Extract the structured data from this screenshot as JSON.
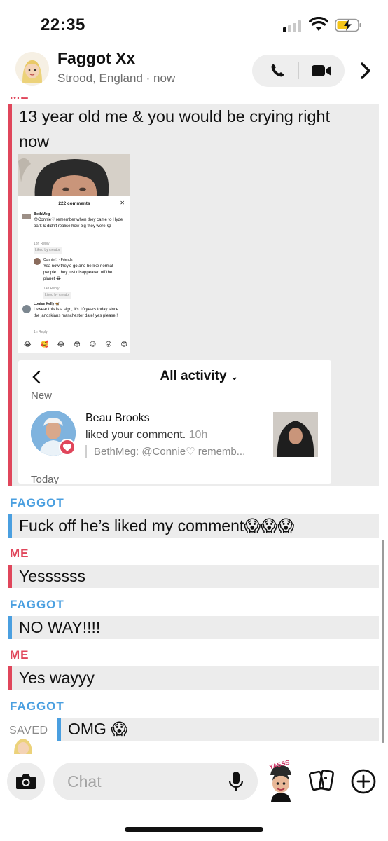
{
  "status": {
    "time": "22:35"
  },
  "header": {
    "name": "Faggot Xx",
    "subtitle": "Strood, England · now"
  },
  "colors": {
    "me": "#e0465b",
    "them": "#4a9fe0",
    "bubble_bg": "#ececec"
  },
  "messages": [
    {
      "sender": "ME",
      "text": "13 year old me & you would be crying right now"
    },
    {
      "sender": "FAGGOT",
      "text": "Fuck off he’s liked my comment😱😱😱"
    },
    {
      "sender": "ME",
      "text": "Yessssss"
    },
    {
      "sender": "FAGGOT",
      "text": "NO WAY!!!!"
    },
    {
      "sender": "ME",
      "text": "Yes wayyy"
    },
    {
      "sender": "FAGGOT",
      "text": "OMG 😱"
    }
  ],
  "saved_label": "SAVED",
  "screenshot_comments": {
    "title": "222 comments",
    "c1_user": "BethMeg",
    "c1_text": "@Connie♡ remember when they came to Hyde park & didn't realise how big they were 😂",
    "c1_meta": "13h   Reply",
    "c1_badge": "Liked by creator",
    "c2_user": "Connie♡ · Friends",
    "c2_text": "Yea now they'd go and be like normal people.. they just disappeared off the planet 😂",
    "c2_meta": "14h   Reply",
    "c2_badge": "Liked by creator",
    "c3_user": "Louise Kelly 🦋",
    "c3_text": "I swear this is a sign, it's 10 years today since the janoskians manchester date! yes please!!",
    "c3_meta": "1h   Reply",
    "emojis": [
      "😂",
      "🥰",
      "😂",
      "😳",
      "😉",
      "😜",
      "😎"
    ]
  },
  "screenshot_activity": {
    "title": "All activity",
    "section_new": "New",
    "name": "Beau Brooks",
    "action": "liked your comment.",
    "time": "10h",
    "quote": "BethMeg: @Connie♡ rememb...",
    "section_today": "Today"
  },
  "footer": {
    "chat_placeholder": "Chat",
    "bitmoji_caption": "YASSS"
  }
}
